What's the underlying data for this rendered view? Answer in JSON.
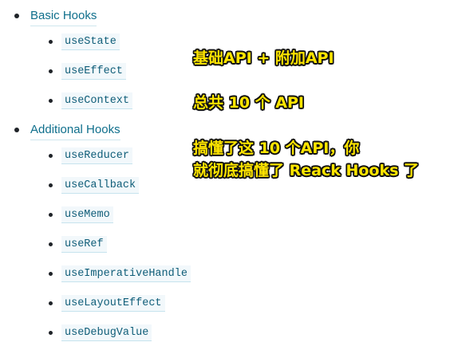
{
  "hooks_list": {
    "basic": {
      "title": "Basic Hooks",
      "items": [
        "useState",
        "useEffect",
        "useContext"
      ]
    },
    "additional": {
      "title": "Additional Hooks",
      "items": [
        "useReducer",
        "useCallback",
        "useMemo",
        "useRef",
        "useImperativeHandle",
        "useLayoutEffect",
        "useDebugValue"
      ]
    }
  },
  "annotation": {
    "line1": "基础API + 附加API",
    "line2": "总共 10 个 API",
    "line3": "搞懂了这 10 个API，你",
    "line4": "就彻底搞懂了 Reack Hooks 了",
    "text_color": "#ffe500",
    "outline_color": "#111111"
  },
  "colors": {
    "link": "#0f6f8c",
    "code": "#0f5d78",
    "code_bg": "#f2f8fb"
  }
}
